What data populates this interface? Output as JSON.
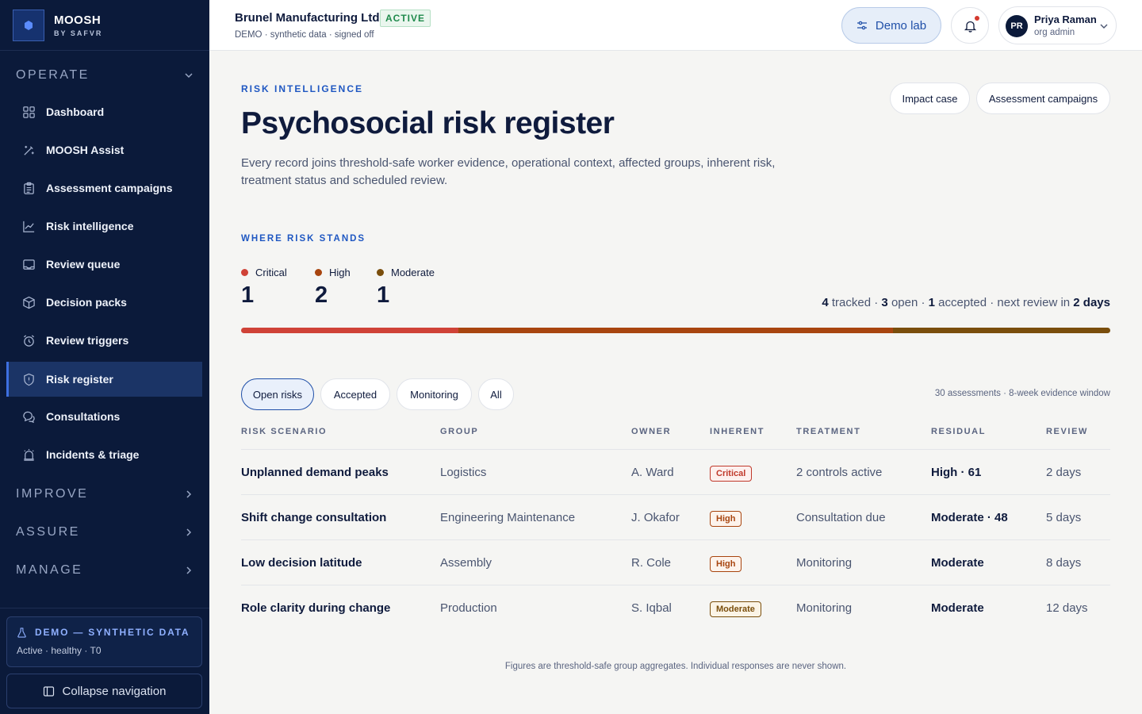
{
  "brand": {
    "name": "MOOSH",
    "sub": "BY SAFVR"
  },
  "nav": {
    "sections": [
      {
        "title": "OPERATE",
        "expanded": true
      },
      {
        "title": "IMPROVE",
        "expanded": false
      },
      {
        "title": "ASSURE",
        "expanded": false
      },
      {
        "title": "MANAGE",
        "expanded": false
      }
    ],
    "items": [
      {
        "label": "Dashboard",
        "icon": "grid-icon"
      },
      {
        "label": "MOOSH Assist",
        "icon": "magic-wand-icon"
      },
      {
        "label": "Assessment campaigns",
        "icon": "clipboard-icon"
      },
      {
        "label": "Risk intelligence",
        "icon": "trend-chart-icon"
      },
      {
        "label": "Review queue",
        "icon": "inbox-icon"
      },
      {
        "label": "Decision packs",
        "icon": "package-icon"
      },
      {
        "label": "Review triggers",
        "icon": "alarm-clock-icon"
      },
      {
        "label": "Risk register",
        "icon": "shield-icon",
        "active": true
      },
      {
        "label": "Consultations",
        "icon": "chat-bubbles-icon"
      },
      {
        "label": "Incidents & triage",
        "icon": "siren-icon"
      }
    ]
  },
  "sidebar_footer": {
    "demo_title": "DEMO — SYNTHETIC DATA",
    "demo_status": "Active · healthy · T0",
    "collapse_label": "Collapse navigation"
  },
  "topbar": {
    "org_name": "Brunel Manufacturing Ltd",
    "org_status": "ACTIVE",
    "org_sub": "DEMO · synthetic data · signed off",
    "demo_lab_label": "Demo lab",
    "user": {
      "initials": "PR",
      "name": "Priya Raman",
      "role": "org admin"
    }
  },
  "header": {
    "eyebrow": "RISK INTELLIGENCE",
    "title": "Psychosocial risk register",
    "description": "Every record joins threshold-safe worker evidence, operational context, affected groups, inherent risk, treatment status and scheduled review.",
    "actions": [
      "Impact case",
      "Assessment campaigns"
    ]
  },
  "risk_summary": {
    "eyebrow": "WHERE RISK STANDS",
    "levels": [
      {
        "label": "Critical",
        "count": "1",
        "color": "#cf4237"
      },
      {
        "label": "High",
        "count": "2",
        "color": "#a8450f"
      },
      {
        "label": "Moderate",
        "count": "1",
        "color": "#7a4e0c"
      }
    ],
    "tracked": "4",
    "tracked_label": "tracked",
    "open": "3",
    "open_label": "open",
    "accepted": "1",
    "accepted_label": "accepted",
    "next_review_label": "next review in",
    "next_review": "2 days",
    "bar": [
      {
        "fraction": 0.25,
        "color": "#cf4237"
      },
      {
        "fraction": 0.5,
        "color": "#a8450f"
      },
      {
        "fraction": 0.25,
        "color": "#7a4e0c"
      }
    ]
  },
  "filters": {
    "tabs": [
      "Open risks",
      "Accepted",
      "Monitoring",
      "All"
    ],
    "active": "Open risks",
    "window_note": "30 assessments · 8-week evidence window"
  },
  "table": {
    "columns": [
      "RISK SCENARIO",
      "GROUP",
      "OWNER",
      "INHERENT",
      "TREATMENT",
      "RESIDUAL",
      "REVIEW"
    ],
    "rows": [
      {
        "scenario": "Unplanned demand peaks",
        "group": "Logistics",
        "owner": "A. Ward",
        "inherent": "Critical",
        "treatment": "2 controls active",
        "residual": "High · 61",
        "review": "2 days"
      },
      {
        "scenario": "Shift change consultation",
        "group": "Engineering Maintenance",
        "owner": "J. Okafor",
        "inherent": "High",
        "treatment": "Consultation due",
        "residual": "Moderate · 48",
        "review": "5 days"
      },
      {
        "scenario": "Low decision latitude",
        "group": "Assembly",
        "owner": "R. Cole",
        "inherent": "High",
        "treatment": "Monitoring",
        "residual": "Moderate",
        "review": "8 days"
      },
      {
        "scenario": "Role clarity during change",
        "group": "Production",
        "owner": "S. Iqbal",
        "inherent": "Moderate",
        "treatment": "Monitoring",
        "residual": "Moderate",
        "review": "12 days"
      }
    ]
  },
  "badge_colors": {
    "Critical": {
      "text": "#c0392b",
      "border": "#c0392b",
      "bg": "#fdf0ee"
    },
    "High": {
      "text": "#a8450f",
      "border": "#a8450f",
      "bg": "#fdf3ec"
    },
    "Moderate": {
      "text": "#7a4e0c",
      "border": "#7a4e0c",
      "bg": "#fbf4e6"
    }
  },
  "footnote": "Figures are threshold-safe group aggregates. Individual responses are never shown."
}
